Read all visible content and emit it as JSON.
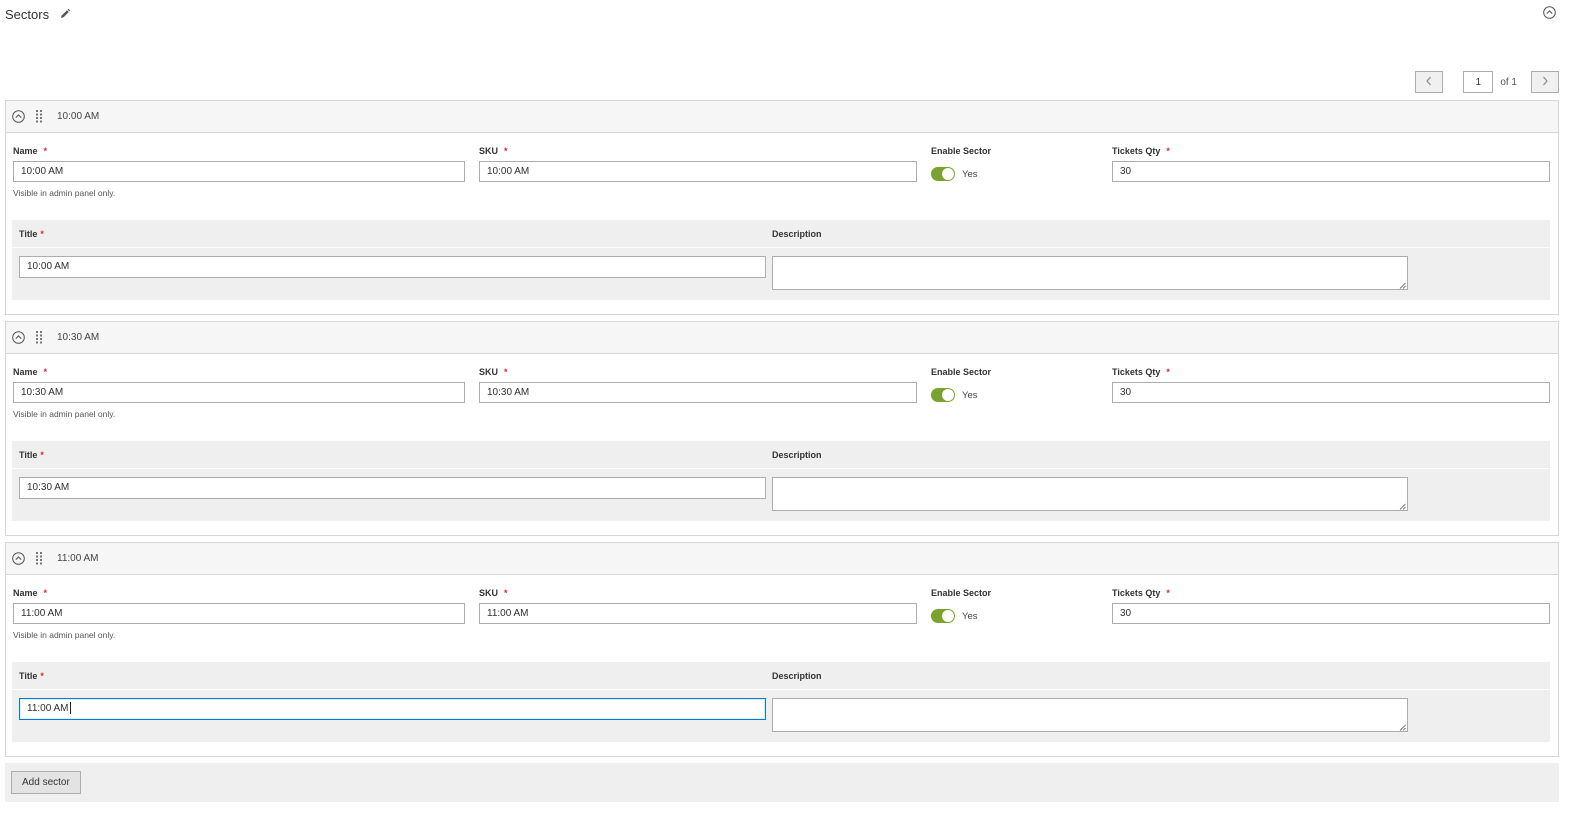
{
  "header": {
    "title": "Sectors"
  },
  "pager": {
    "current_page": "1",
    "of_label": "of 1"
  },
  "labels": {
    "name": "Name",
    "sku": "SKU",
    "enable_sector": "Enable Sector",
    "tickets_qty": "Tickets Qty",
    "name_note": "Visible in admin panel only.",
    "title": "Title",
    "description": "Description",
    "required_mark": "*"
  },
  "sectors": [
    {
      "head_title": "10:00 AM",
      "name": "10:00 AM",
      "sku": "10:00 AM",
      "enabled_text": "Yes",
      "tickets_qty": "30",
      "title": "10:00 AM",
      "description": ""
    },
    {
      "head_title": "10:30 AM",
      "name": "10:30 AM",
      "sku": "10:30 AM",
      "enabled_text": "Yes",
      "tickets_qty": "30",
      "title": "10:30 AM",
      "description": ""
    },
    {
      "head_title": "11:00 AM",
      "name": "11:00 AM",
      "sku": "11:00 AM",
      "enabled_text": "Yes",
      "tickets_qty": "30",
      "title": "11:00 AM",
      "description": ""
    }
  ],
  "add_button": "Add sector",
  "colors": {
    "toggle_on": "#79a22e",
    "required": "#e22626",
    "focus_border": "#007bdb"
  },
  "icons": [
    "pencil-icon",
    "collapse-icon",
    "chevron-left-icon",
    "chevron-right-icon",
    "drag-handle-icon",
    "resize-handle-icon"
  ]
}
